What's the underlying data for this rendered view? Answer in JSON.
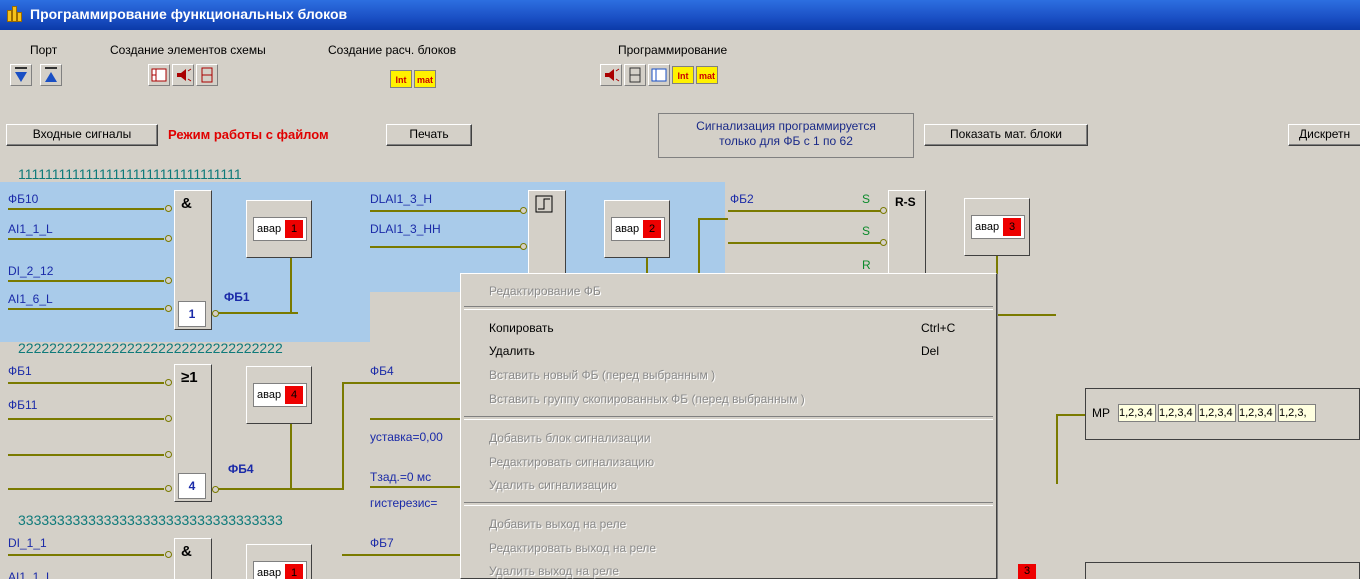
{
  "window": {
    "title": "Программирование функциональных блоков"
  },
  "menu": [
    "Порт",
    "Создание элементов схемы",
    "Создание расч. блоков",
    "Программирование"
  ],
  "toolbar": {
    "int_label": "Int",
    "mat_label": "mat"
  },
  "buttons": {
    "input_signals": "Входные сигналы",
    "file_mode": "Режим работы с файлом",
    "print": "Печать",
    "show_math_blocks": "Показать мат. блоки",
    "discrete": "Дискретн"
  },
  "note": {
    "line1": "Сигнализация программируется",
    "line2": "только для ФБ с 1 по 62"
  },
  "rows": [
    {
      "digits": "111111111111111111111111111111111"
    },
    {
      "digits": "2222222222222222222222222222222222"
    },
    {
      "digits": "3333333333333333333333333333333333"
    }
  ],
  "fb1": {
    "inputs": [
      "ФБ10",
      "AI1_1_L",
      "DI_2_12",
      "AI1_6_L"
    ],
    "symbol": "&",
    "number": "1",
    "name": "ФБ1",
    "alarm": "авар",
    "alarm_num": "1"
  },
  "fb2": {
    "inputs": [
      "DLAI1_3_H",
      "DLAI1_3_HH"
    ],
    "symbol": "⭱",
    "alarm": "авар",
    "alarm_num": "2"
  },
  "fb3": {
    "input": "ФБ2",
    "s1": "S",
    "s2": "S",
    "r": "R",
    "symbol": "R-S",
    "alarm": "авар",
    "alarm_num": "3"
  },
  "fb4": {
    "inputs": [
      "ФБ1",
      "ФБ11"
    ],
    "symbol": "≥1",
    "number": "4",
    "name": "ФБ4",
    "alarm": "авар",
    "alarm_num": "4"
  },
  "fb5": {
    "input": "ФБ4",
    "setpoint": "уставка=0,00",
    "tdelay": "Тзад.=0 мс",
    "hysteresis": "гистерезис="
  },
  "fb7": {
    "inputs": [
      "DI_1_1",
      "AI1_1_L"
    ],
    "symbol": "&",
    "alarm": "авар",
    "alarm_num": "1",
    "next": "ФБ7",
    "alarm2_num": "3"
  },
  "context_menu": {
    "header": "Редактирование ФБ",
    "copy": "Копировать",
    "copy_sc": "Ctrl+C",
    "delete": "Удалить",
    "delete_sc": "Del",
    "insert_new": "Вставить новый ФБ (перед выбранным )",
    "insert_group": "Вставить группу скопированных ФБ (перед выбранным )",
    "add_alarm": "Добавить  блок сигнализации",
    "edit_alarm": "Редактировать сигнализацию",
    "delete_alarm": "Удалить сигнализацию",
    "add_relay": "Добавить  выход на реле",
    "edit_relay": "Редактировать выход на реле",
    "delete_relay": "Удалить выход на реле"
  },
  "mr": {
    "label": "МР",
    "cells": [
      "1,2,3,4",
      "1,2,3,4",
      "1,2,3,4",
      "1,2,3,4",
      "1,2,3,"
    ]
  },
  "colors": {
    "title_bar": "#1a4fc4",
    "selection": "#a9cbea",
    "wire": "#7a7a00",
    "alarm": "#e00000"
  }
}
